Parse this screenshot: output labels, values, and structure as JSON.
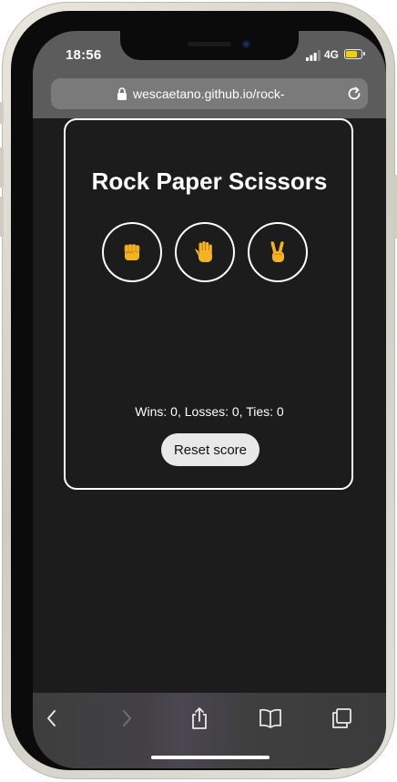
{
  "status_bar": {
    "time": "18:56",
    "network": "4G",
    "battery_level": 0.8,
    "battery_color": "#f5d000"
  },
  "browser": {
    "url": "wescaetano.github.io/rock-"
  },
  "game": {
    "title": "Rock Paper Scissors",
    "choices": [
      {
        "icon": "fist-icon",
        "emoji": "✊"
      },
      {
        "icon": "raised-hand-icon",
        "emoji": "🖐"
      },
      {
        "icon": "victory-hand-icon",
        "emoji": "✌"
      }
    ],
    "score_text": "Wins: 0, Losses: 0, Ties: 0",
    "reset_label": "Reset score",
    "emoji_color": "#f5b324"
  },
  "toolbar": {
    "icons": [
      "back-icon",
      "forward-icon",
      "share-icon",
      "bookmarks-icon",
      "tabs-icon"
    ]
  }
}
